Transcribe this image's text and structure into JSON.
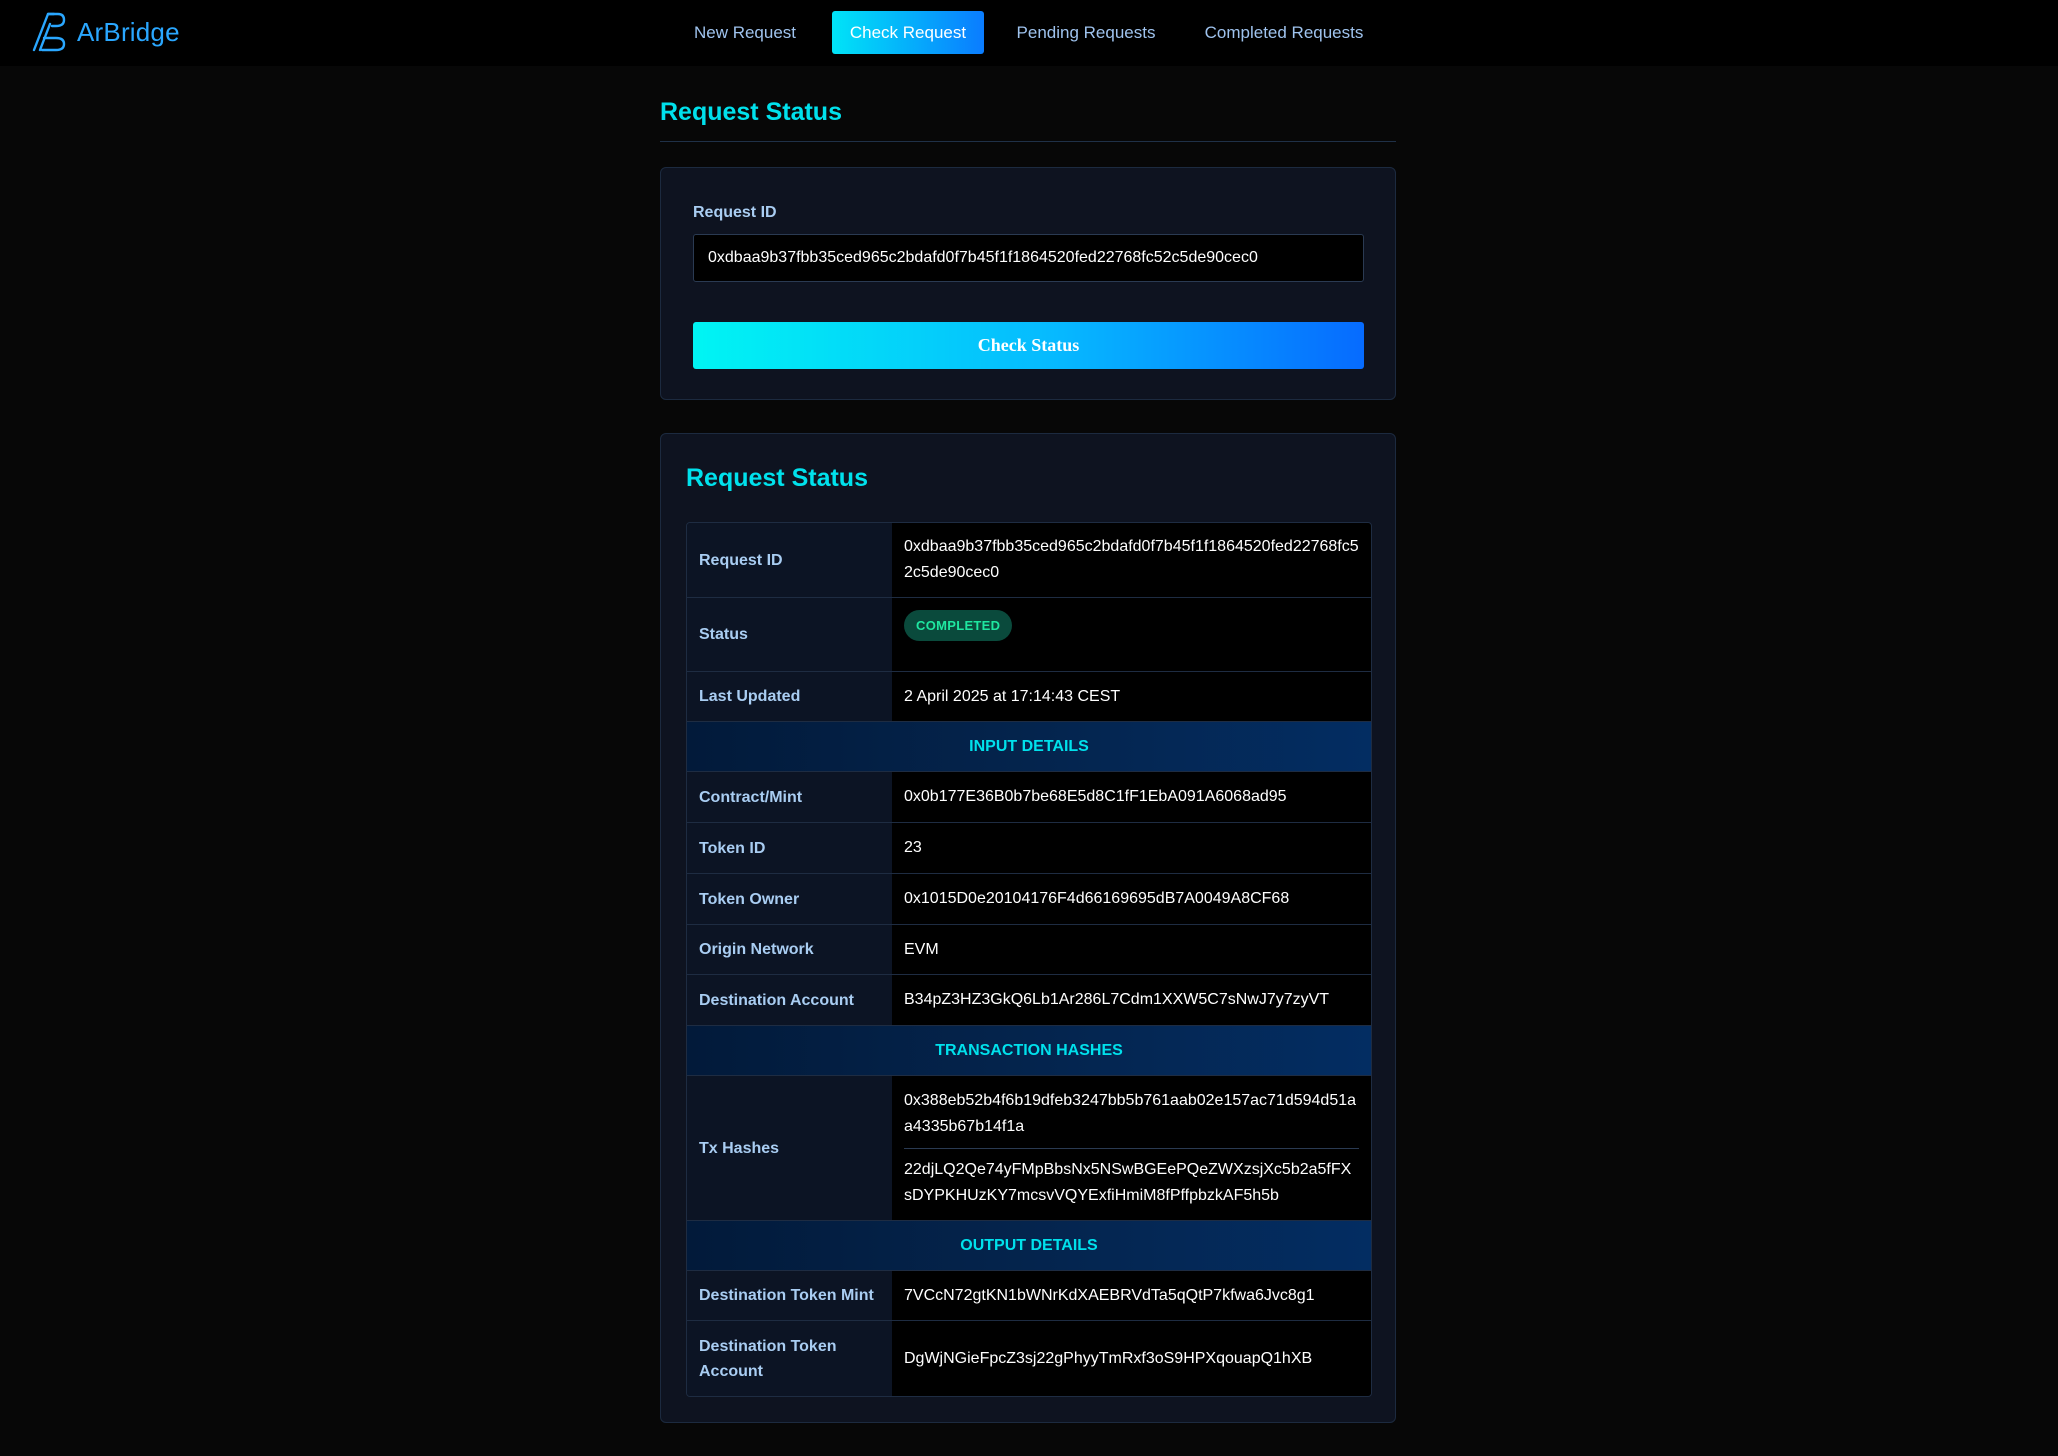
{
  "app": {
    "name": "ArBridge",
    "accent": "#00e1ec",
    "brand": "#2aa7ff"
  },
  "nav": {
    "items": [
      {
        "label": "New Request",
        "active": false
      },
      {
        "label": "Check Request",
        "active": true
      },
      {
        "label": "Pending Requests",
        "active": false
      },
      {
        "label": "Completed Requests",
        "active": false
      }
    ]
  },
  "page": {
    "title": "Request Status"
  },
  "form": {
    "label": "Request ID",
    "value": "0xdbaa9b37fbb35ced965c2bdafd0f7b45f1f1864520fed22768fc52c5de90cec0",
    "button_label": "Check Status"
  },
  "status": {
    "title": "Request Status",
    "rows": {
      "request_id": {
        "label": "Request ID",
        "value": "0xdbaa9b37fbb35ced965c2bdafd0f7b45f1f1864520fed22768fc52c5de90cec0"
      },
      "status": {
        "label": "Status",
        "value": "COMPLETED",
        "color": "#1fe6a0"
      },
      "last_updated": {
        "label": "Last Updated",
        "value": "2 April 2025 at 17:14:43 CEST"
      }
    },
    "sections": {
      "input": {
        "title": "INPUT DETAILS",
        "rows": [
          {
            "label": "Contract/Mint",
            "value": "0x0b177E36B0b7be68E5d8C1fF1EbA091A6068ad95"
          },
          {
            "label": "Token ID",
            "value": "23"
          },
          {
            "label": "Token Owner",
            "value": "0x1015D0e20104176F4d66169695dB7A0049A8CF68"
          },
          {
            "label": "Origin Network",
            "value": "EVM"
          },
          {
            "label": "Destination Account",
            "value": "B34pZ3HZ3GkQ6Lb1Ar286L7Cdm1XXW5C7sNwJ7y7zyVT"
          }
        ]
      },
      "tx": {
        "title": "TRANSACTION HASHES",
        "label": "Tx Hashes",
        "hashes": [
          "0x388eb52b4f6b19dfeb3247bb5b761aab02e157ac71d594d51aa4335b67b14f1a",
          "22djLQ2Qe74yFMpBbsNx5NSwBGEePQeZWXzsjXc5b2a5fFXsDYPKHUzKY7mcsvVQYExfiHmiM8fPffpbzkAF5h5b"
        ]
      },
      "output": {
        "title": "OUTPUT DETAILS",
        "rows": [
          {
            "label": "Destination Token Mint",
            "value": "7VCcN72gtKN1bWNrKdXAEBRVdTa5qQtP7kfwa6Jvc8g1"
          },
          {
            "label": "Destination Token Account",
            "value": "DgWjNGieFpcZ3sj22gPhyyTmRxf3oS9HPXqouapQ1hXB"
          }
        ]
      }
    }
  }
}
